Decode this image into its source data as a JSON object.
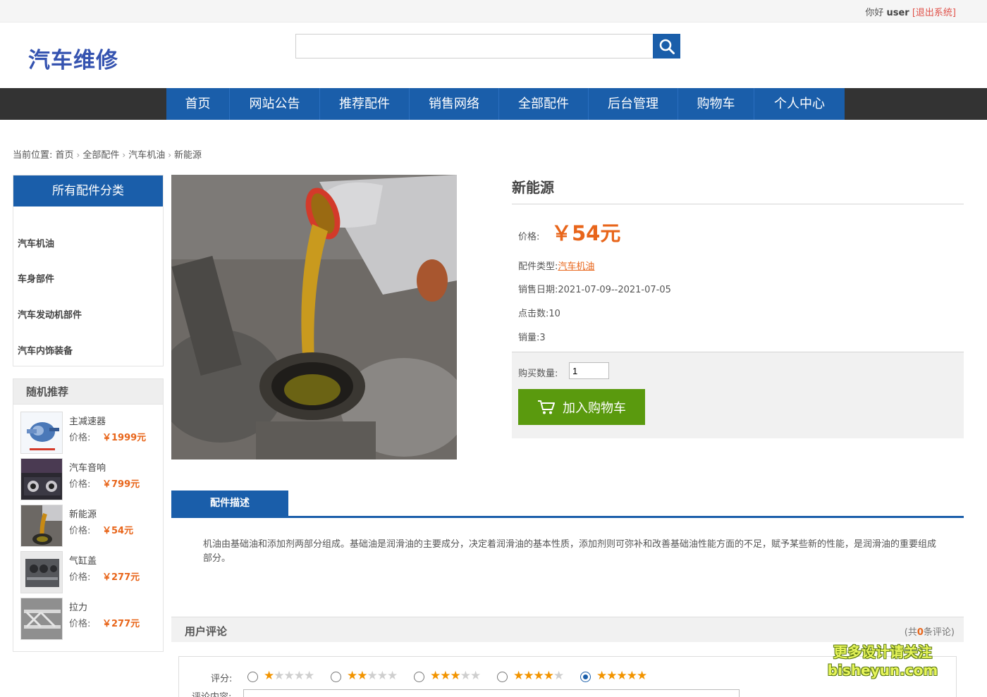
{
  "topbar": {
    "greeting": "你好 ",
    "username": "user",
    "logout": "[退出系统]"
  },
  "header": {
    "logo": "汽车维修",
    "search_placeholder": ""
  },
  "nav": [
    {
      "label": "首页"
    },
    {
      "label": "网站公告"
    },
    {
      "label": "推荐配件"
    },
    {
      "label": "销售网络"
    },
    {
      "label": "全部配件"
    },
    {
      "label": "后台管理"
    },
    {
      "label": "购物车"
    },
    {
      "label": "个人中心"
    }
  ],
  "breadcrumb": {
    "prefix": "当前位置:",
    "items": [
      "首页",
      "全部配件",
      "汽车机油",
      "新能源"
    ]
  },
  "sidebar": {
    "category_title": "所有配件分类",
    "categories": [
      "汽车机油",
      "车身部件",
      "汽车发动机部件",
      "汽车内饰装备"
    ],
    "recommend_title": "随机推荐",
    "price_label": "价格:",
    "recommends": [
      {
        "name": "主减速器",
        "price": "￥1999元"
      },
      {
        "name": "汽车音响",
        "price": "￥799元"
      },
      {
        "name": "新能源",
        "price": "￥54元"
      },
      {
        "name": "气缸盖",
        "price": "￥277元"
      },
      {
        "name": "拉力",
        "price": "￥277元"
      }
    ]
  },
  "product": {
    "title": "新能源",
    "price_label": "价格:",
    "price": "￥54元",
    "type_label": "配件类型:",
    "type_value": "汽车机油",
    "date_label": "销售日期:",
    "date_value": "2021-07-09--2021-07-05",
    "clicks_label": "点击数:",
    "clicks_value": "10",
    "sales_label": "销量:",
    "sales_value": "3",
    "qty_label": "购买数量:",
    "qty_value": "1",
    "cart_button": "加入购物车"
  },
  "description": {
    "tab": "配件描述",
    "text": "机油由基础油和添加剂两部分组成。基础油是润滑油的主要成分，决定着润滑油的基本性质，添加剂则可弥补和改善基础油性能方面的不足，赋予某些新的性能，是润滑油的重要组成部分。"
  },
  "reviews": {
    "title": "用户评论",
    "count_prefix": "(共",
    "count": "0",
    "count_suffix": "条评论)",
    "score_label": "评分:",
    "content_label": "评论内容:",
    "selected_score": 5,
    "options": [
      1,
      2,
      3,
      4,
      5
    ]
  },
  "watermark": {
    "line1": "更多设计请关注",
    "line2": "bisheyun.com"
  },
  "colors": {
    "primary": "#1a5eaa",
    "accent": "#e8651a",
    "cart_green": "#5a9a0e",
    "nav_bg": "#333333",
    "star": "#f29400"
  }
}
